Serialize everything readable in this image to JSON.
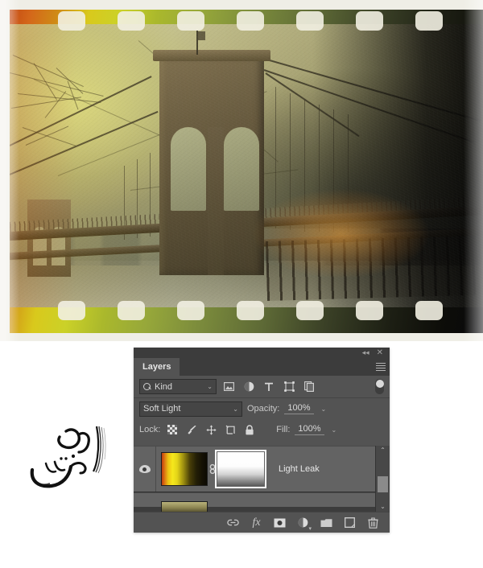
{
  "artwork": {
    "name": "vintage-film-strip-brooklyn-bridge",
    "subject": "Brooklyn Bridge photograph with film-strip border and light-leak effect",
    "alt": "Sepia toned Brooklyn Bridge photo inside a 35mm film strip with orange-to-yellow light leak on the left and heavy black shadow on the right"
  },
  "watermark": {
    "name": "webtadris-logo",
    "text_fa": "وب تدریس"
  },
  "panel": {
    "titlebar": {
      "collapse_icon": "«",
      "close_icon": "×"
    },
    "tab_label": "Layers",
    "menu_icon": "panel-menu-icon",
    "filter": {
      "search_icon": "search-icon",
      "kind_label": "Kind",
      "caret": "⌄",
      "filter_buttons": [
        {
          "name": "filter-pixel-layers",
          "icon": "image-icon"
        },
        {
          "name": "filter-adjustment-layers",
          "icon": "adjustment-circle-icon"
        },
        {
          "name": "filter-type-layers",
          "icon": "type-t-icon"
        },
        {
          "name": "filter-shape-layers",
          "icon": "shape-icon"
        },
        {
          "name": "filter-smart-objects",
          "icon": "smart-object-icon"
        }
      ],
      "toggle_state": "on"
    },
    "blend": {
      "mode": "Soft Light",
      "opacity_label": "Opacity:",
      "opacity_value": "100%"
    },
    "lock": {
      "label": "Lock:",
      "buttons": [
        {
          "name": "lock-transparent-pixels",
          "icon": "checkerboard-icon"
        },
        {
          "name": "lock-image-pixels",
          "icon": "brush-icon"
        },
        {
          "name": "lock-position",
          "icon": "move-arrows-icon"
        },
        {
          "name": "lock-artboard-nesting",
          "icon": "artboard-icon"
        },
        {
          "name": "lock-all",
          "icon": "lock-icon"
        }
      ],
      "fill_label": "Fill:",
      "fill_value": "100%"
    },
    "layers": [
      {
        "name": "Light Leak",
        "visible": true,
        "thumbnail": "orange-yellow-to-black-gradient",
        "mask_thumbnail": "white-to-black-vertical-gradient",
        "linked": true,
        "selected": true
      }
    ],
    "partial_layer_below": {
      "thumbnail": "olive-photo-thumbnail"
    },
    "scrollbar": {
      "up_arrow": "⌃",
      "down_arrow": "⌄"
    },
    "bottom_buttons": [
      {
        "name": "link-layers-button",
        "icon": "link-icon",
        "label": ""
      },
      {
        "name": "add-layer-style-button",
        "icon": "fx-icon",
        "label": "fx"
      },
      {
        "name": "add-layer-mask-button",
        "icon": "mask-icon",
        "label": ""
      },
      {
        "name": "new-fill-adjustment-layer-button",
        "icon": "half-filled-circle-icon",
        "label": ""
      },
      {
        "name": "new-group-button",
        "icon": "folder-icon",
        "label": ""
      },
      {
        "name": "new-layer-button",
        "icon": "new-layer-icon",
        "label": ""
      },
      {
        "name": "delete-layer-button",
        "icon": "trash-icon",
        "label": ""
      }
    ]
  },
  "colors": {
    "panel_bg": "#535353",
    "panel_header": "#3c3c3c",
    "list_bg": "#3c3c3c",
    "layer_selected": "#636363",
    "text": "#d4d4d4",
    "leak_orange": "#c44a12",
    "leak_yellow": "#f5e81c",
    "shadow_black": "#08080a"
  }
}
